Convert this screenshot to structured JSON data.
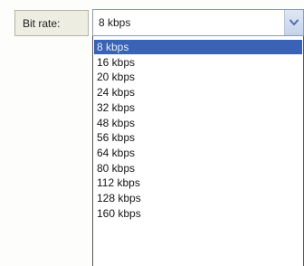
{
  "field": {
    "label": "Bit rate:",
    "selected_value": "8 kbps",
    "dropdown_icon": "chevron-down-icon"
  },
  "options": [
    {
      "label": "8 kbps",
      "selected": true
    },
    {
      "label": "16 kbps",
      "selected": false
    },
    {
      "label": "20 kbps",
      "selected": false
    },
    {
      "label": "24 kbps",
      "selected": false
    },
    {
      "label": "32 kbps",
      "selected": false
    },
    {
      "label": "48 kbps",
      "selected": false
    },
    {
      "label": "56 kbps",
      "selected": false
    },
    {
      "label": "64 kbps",
      "selected": false
    },
    {
      "label": "80 kbps",
      "selected": false
    },
    {
      "label": "112 kbps",
      "selected": false
    },
    {
      "label": "128 kbps",
      "selected": false
    },
    {
      "label": "160 kbps",
      "selected": false
    }
  ],
  "colors": {
    "highlight": "#3a63b6",
    "label_background": "#eeede2",
    "arrow_button": "#c5d3ea"
  }
}
